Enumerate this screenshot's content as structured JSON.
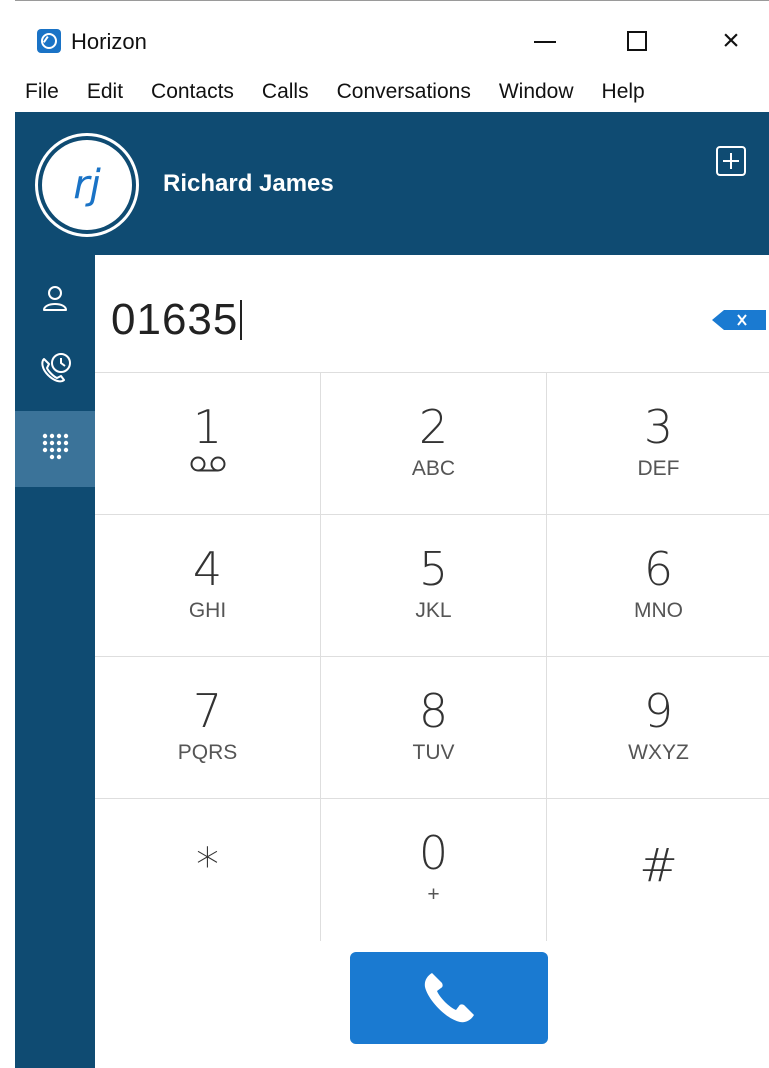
{
  "window": {
    "title": "Horizon",
    "controls": {
      "minimize": "minimize",
      "maximize": "maximize",
      "close": "×"
    }
  },
  "menu": [
    "File",
    "Edit",
    "Contacts",
    "Calls",
    "Conversations",
    "Window",
    "Help"
  ],
  "header": {
    "avatar_initials": "rj",
    "user_name": "Richard James",
    "add_icon": "add-square-icon"
  },
  "sidebar": {
    "items": [
      {
        "name": "contacts",
        "icon": "person-icon",
        "active": false
      },
      {
        "name": "history",
        "icon": "phone-clock-icon",
        "active": false
      },
      {
        "name": "dialpad",
        "icon": "dialpad-icon",
        "active": true
      }
    ]
  },
  "dialer": {
    "number": "01635",
    "backspace_icon": "backspace-icon",
    "keys": [
      {
        "digit": "1",
        "sub": "",
        "sub_icon": "voicemail-icon"
      },
      {
        "digit": "2",
        "sub": "ABC"
      },
      {
        "digit": "3",
        "sub": "DEF"
      },
      {
        "digit": "4",
        "sub": "GHI"
      },
      {
        "digit": "5",
        "sub": "JKL"
      },
      {
        "digit": "6",
        "sub": "MNO"
      },
      {
        "digit": "7",
        "sub": "PQRS"
      },
      {
        "digit": "8",
        "sub": "TUV"
      },
      {
        "digit": "9",
        "sub": "WXYZ"
      },
      {
        "digit": "*",
        "sub": ""
      },
      {
        "digit": "0",
        "sub": "+"
      },
      {
        "digit": "#",
        "sub": ""
      }
    ],
    "call_icon": "phone-icon"
  },
  "colors": {
    "header_bg": "#0f4b72",
    "sidebar_active": "#3b7399",
    "call_button": "#1a7ad1",
    "accent": "#1a73c6"
  }
}
